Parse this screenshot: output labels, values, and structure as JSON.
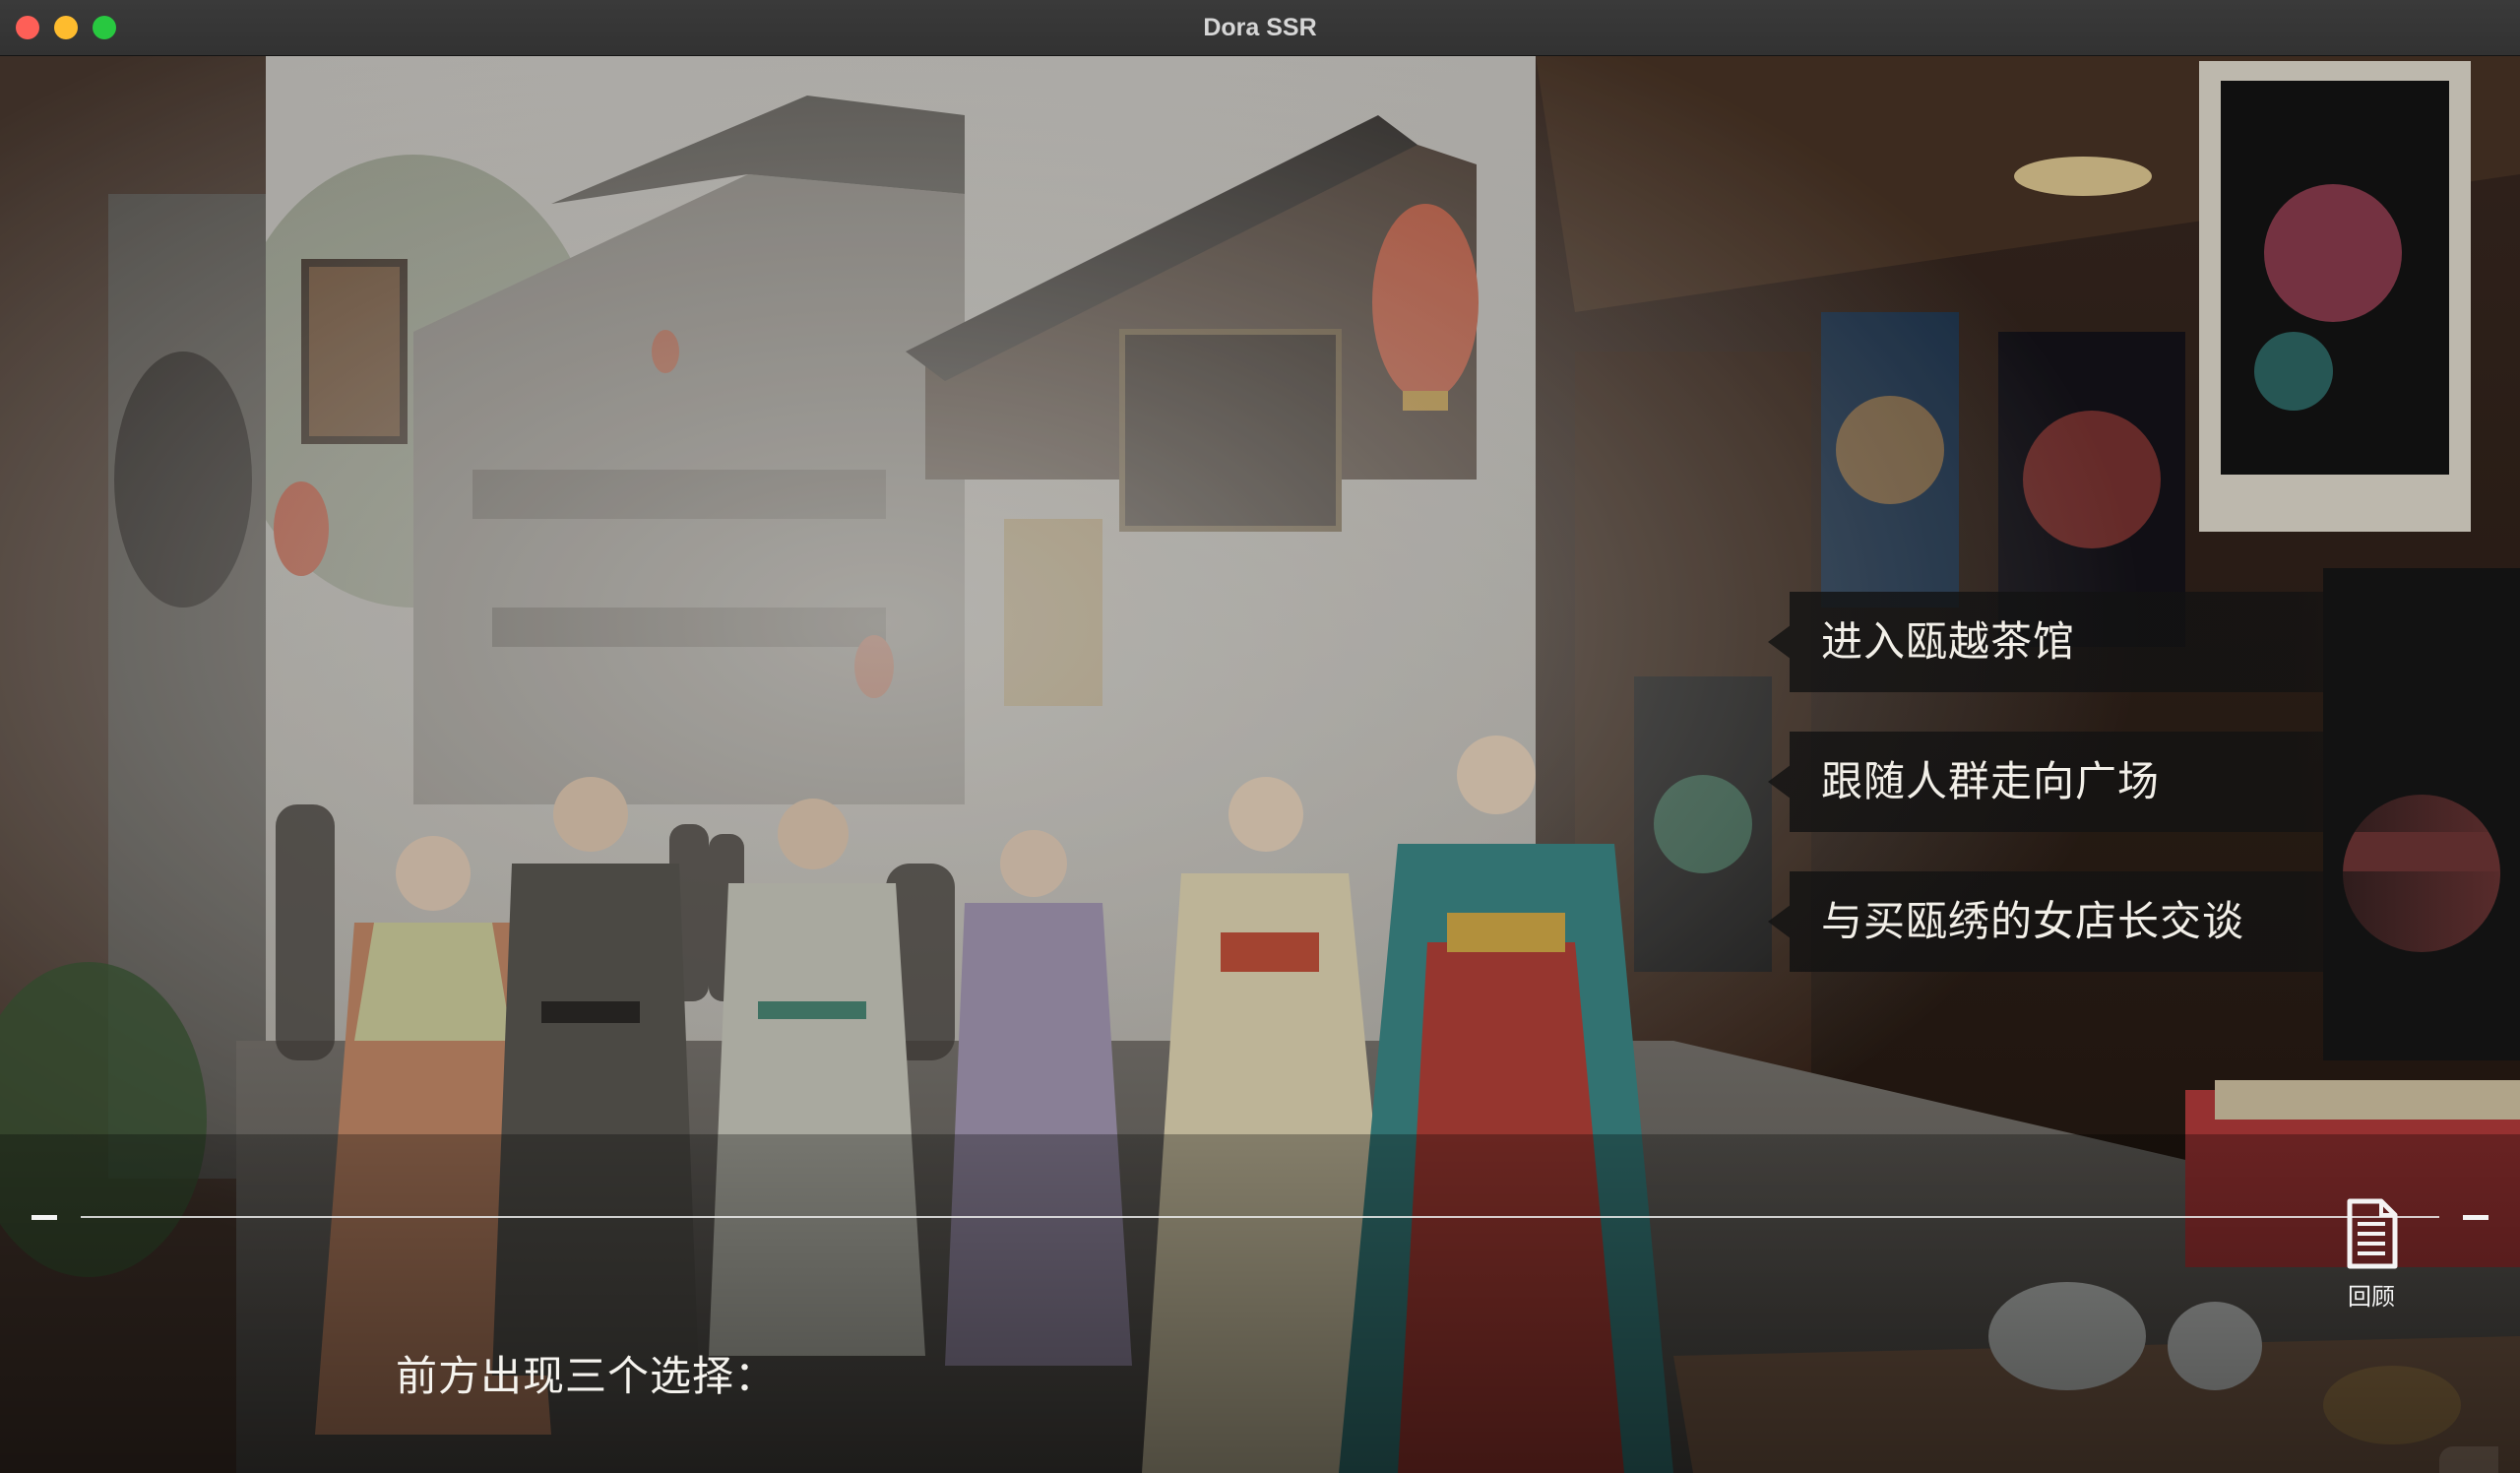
{
  "window": {
    "title": "Dora SSR",
    "controls": [
      "close",
      "minimize",
      "maximize"
    ],
    "colors": {
      "close": "#fe5f57",
      "minimize": "#febc2e",
      "maximize": "#28c840"
    }
  },
  "scene": {
    "background": "ancient-chinese-street-illustration"
  },
  "choices": [
    {
      "label": "进入瓯越茶馆"
    },
    {
      "label": "跟随人群走向广场"
    },
    {
      "label": "与买瓯绣的女店长交谈"
    }
  ],
  "dialogue": {
    "text": "前方出现三个选择："
  },
  "backlog": {
    "label": "回顾",
    "icon": "document-list-icon"
  }
}
